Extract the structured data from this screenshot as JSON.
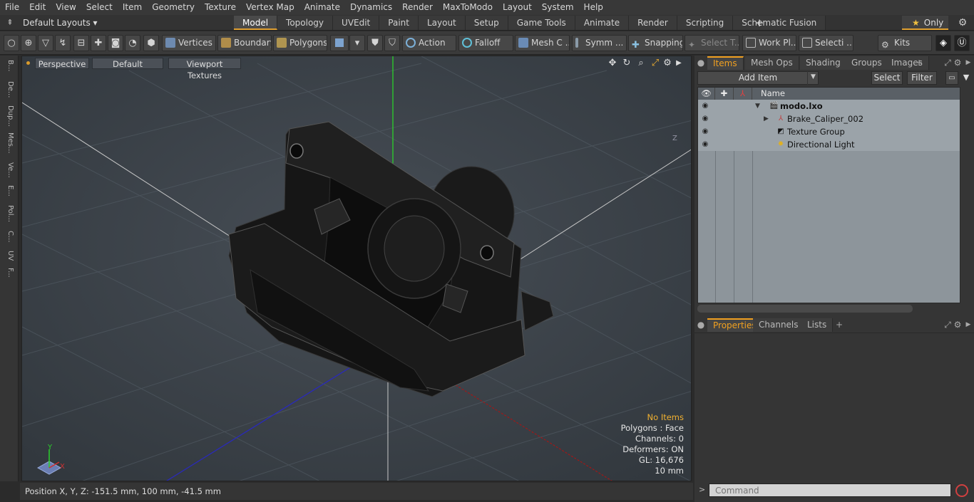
{
  "menu": [
    "File",
    "Edit",
    "View",
    "Select",
    "Item",
    "Geometry",
    "Texture",
    "Vertex Map",
    "Animate",
    "Dynamics",
    "Render",
    "MaxToModo",
    "Layout",
    "System",
    "Help"
  ],
  "layouts_label": "Default Layouts",
  "tabs": [
    {
      "label": "Model",
      "active": true
    },
    {
      "label": "Topology",
      "active": false
    },
    {
      "label": "UVEdit",
      "active": false
    },
    {
      "label": "Paint",
      "active": false
    },
    {
      "label": "Layout",
      "active": false
    },
    {
      "label": "Setup",
      "active": false
    },
    {
      "label": "Game Tools",
      "active": false
    },
    {
      "label": "Animate",
      "active": false
    },
    {
      "label": "Render",
      "active": false
    },
    {
      "label": "Scripting",
      "active": false
    },
    {
      "label": "Schematic Fusion",
      "active": false
    }
  ],
  "only_label": "Only",
  "toolbar": {
    "vertices": "Vertices",
    "boundary": "Boundary",
    "polygons": "Polygons",
    "action": "Action",
    "falloff": "Falloff",
    "mesh": "Mesh C ...",
    "symm": "Symm ...",
    "snapping": "Snapping",
    "select_t": "Select T...",
    "work_pl": "Work Pl...",
    "selecti": "Selecti ...",
    "kits": "Kits"
  },
  "left_tabs": [
    "B...",
    "De...",
    "Dup...",
    "Mes...",
    "Ve...",
    "E...",
    "Pol...",
    "C...",
    "UV",
    "F..."
  ],
  "viewport": {
    "perspective": "Perspective",
    "default": "Default",
    "textures": "Viewport Textures",
    "info": {
      "no_items": "No Items",
      "polygons": "Polygons : Face",
      "channels": "Channels: 0",
      "deformers": "Deformers: ON",
      "gl": "GL: 16,676",
      "scale": "10 mm"
    },
    "axis_y": "Y",
    "axis_x": "X",
    "axis_z": "Z"
  },
  "status": "Position X, Y, Z:   -151.5 mm, 100 mm, -41.5 mm",
  "items_panel": {
    "tabs": [
      {
        "label": "Items",
        "active": true
      },
      {
        "label": "Mesh Ops",
        "active": false
      },
      {
        "label": "Shading",
        "active": false
      },
      {
        "label": "Groups",
        "active": false
      },
      {
        "label": "Images",
        "active": false
      }
    ],
    "add_item": "Add Item",
    "select": "Select",
    "filter": "Filter",
    "name_header": "Name",
    "items": [
      {
        "label": "modo.lxo",
        "bold": true
      },
      {
        "label": "Brake_Caliper_002",
        "bold": false
      },
      {
        "label": "Texture Group",
        "bold": false
      },
      {
        "label": "Directional Light",
        "bold": false
      }
    ]
  },
  "props_panel": {
    "tabs": [
      {
        "label": "Properties",
        "active": true
      },
      {
        "label": "Channels",
        "active": false
      },
      {
        "label": "Lists",
        "active": false
      }
    ]
  },
  "command": {
    "placeholder": "Command"
  }
}
